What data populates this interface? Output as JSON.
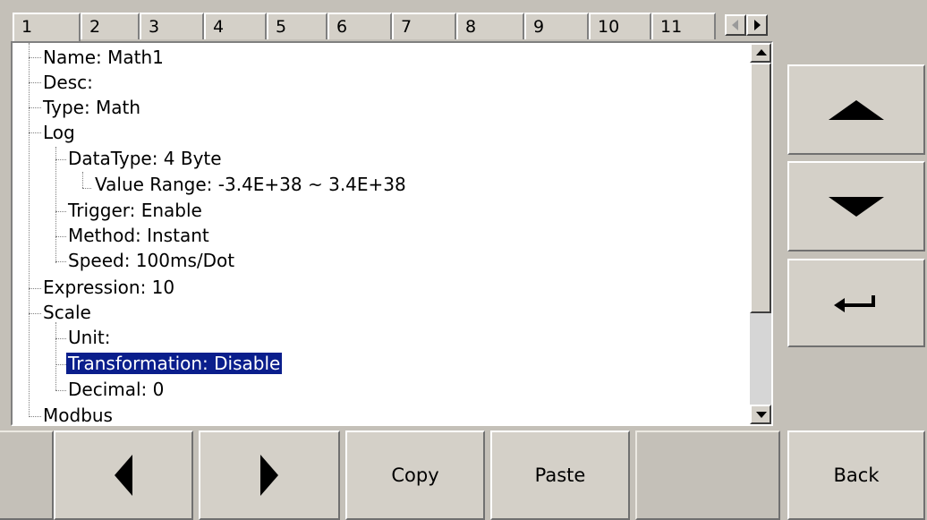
{
  "tabs": [
    "1",
    "2",
    "3",
    "4",
    "5",
    "6",
    "7",
    "8",
    "9",
    "10",
    "11"
  ],
  "active_tab": "1",
  "tree": [
    {
      "label": "Name: Math1",
      "level": 0
    },
    {
      "label": "Desc:",
      "level": 0
    },
    {
      "label": "Type: Math",
      "level": 0
    },
    {
      "label": "Log",
      "level": 0
    },
    {
      "label": "DataType: 4 Byte",
      "level": 1
    },
    {
      "label": "Value Range: -3.4E+38  ~ 3.4E+38",
      "level": 2
    },
    {
      "label": "Trigger: Enable",
      "level": 1
    },
    {
      "label": "Method: Instant",
      "level": 1
    },
    {
      "label": "Speed: 100ms/Dot",
      "level": 1
    },
    {
      "label": "Expression: 10",
      "level": 0
    },
    {
      "label": "Scale",
      "level": 0
    },
    {
      "label": "Unit:",
      "level": 1
    },
    {
      "label": "Transformation: Disable",
      "level": 1,
      "selected": true
    },
    {
      "label": "Decimal: 0",
      "level": 1
    },
    {
      "label": "Modbus",
      "level": 0
    }
  ],
  "side_buttons": {
    "up": "up-arrow-icon",
    "down": "down-arrow-icon",
    "enter": "enter-icon"
  },
  "bottom_buttons": {
    "prev": "left-arrow-icon",
    "next": "right-arrow-icon",
    "copy": "Copy",
    "paste": "Paste",
    "back": "Back"
  },
  "colors": {
    "selection": "#0a1e8c",
    "background": "#c4c0b8",
    "button": "#d4d0c8"
  }
}
